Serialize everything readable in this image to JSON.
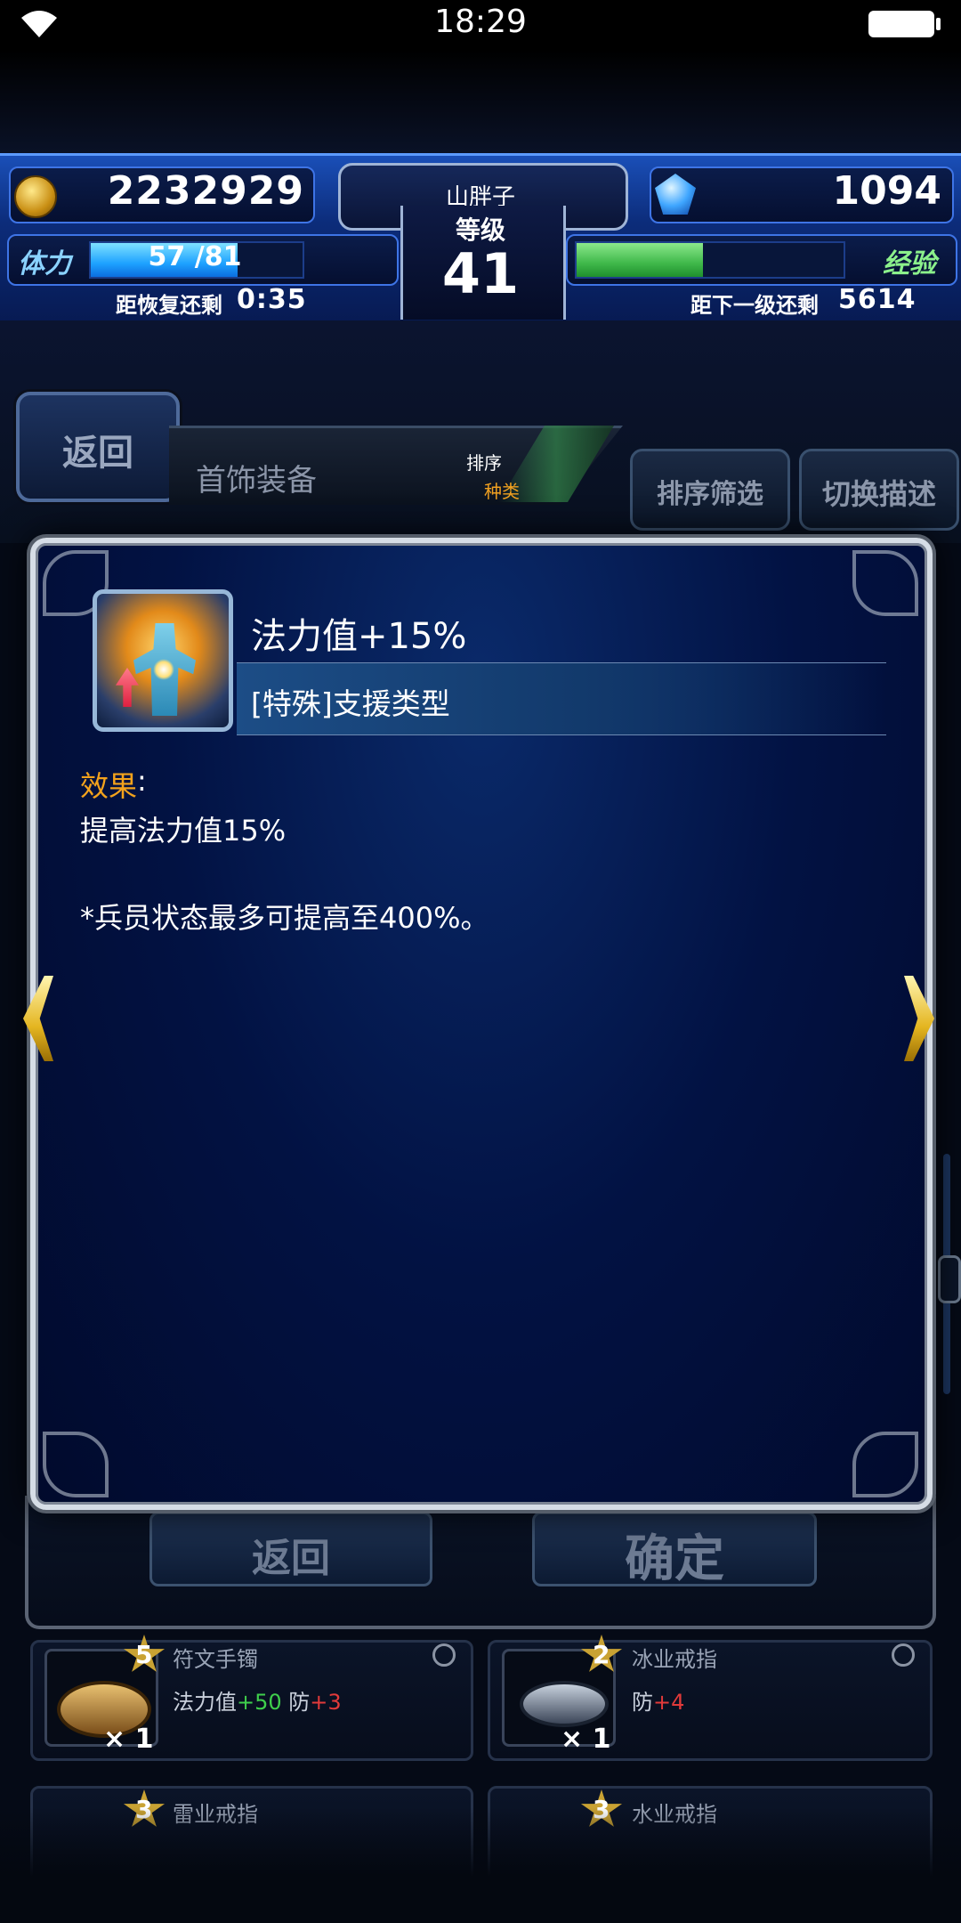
{
  "status_bar": {
    "time": "18:29",
    "wifi_icon": "wifi-icon",
    "battery_icon": "battery-icon"
  },
  "header": {
    "gold": "2232929",
    "gems": "1094",
    "player_name": "山胖子",
    "level_label": "等级",
    "level": "41",
    "stamina_label": "体力",
    "stamina_text": "57 /81",
    "stamina_current": 57,
    "stamina_max": 81,
    "recover_label": "距恢复还剩",
    "recover_time": "0:35",
    "exp_label": "经验",
    "exp_fraction": 0.48,
    "next_level_label": "距下一级还剩",
    "next_level_value": "5614"
  },
  "toolbar": {
    "back_label": "返回",
    "category": "首饰装备",
    "sort_label": "排序",
    "sort_value": "种类",
    "sort_filter_label": "排序筛选",
    "switch_desc_label": "切换描述"
  },
  "dialog": {
    "skill_name": "法力值+15%",
    "skill_type": "[特殊]支援类型",
    "effect_label": "效果",
    "effect_colon": ":",
    "effect_text": "提高法力值15%",
    "note_text": "*兵员状态最多可提高至400%。",
    "skill_icon": "magic-power-up-icon"
  },
  "bottom_buttons": {
    "back_label": "返回",
    "confirm_label": "确定"
  },
  "items": [
    {
      "stars": "5",
      "name": "符文手镯",
      "stat_prefix": "法力值",
      "stat_bonus": "+50",
      "stat_prefix2": "防",
      "stat_bonus2": "+3",
      "count": "× 1"
    },
    {
      "stars": "2",
      "name": "冰业戒指",
      "stat_prefix": "防",
      "stat_bonus": "+4",
      "count": "× 1"
    },
    {
      "stars": "3",
      "name": "雷业戒指"
    },
    {
      "stars": "3",
      "name": "水业戒指"
    }
  ],
  "colors": {
    "accent_gold": "#f3a21c",
    "stamina_blue": "#1ea2ff",
    "exp_green": "#3fb84a",
    "dialog_bg": "#021243"
  }
}
